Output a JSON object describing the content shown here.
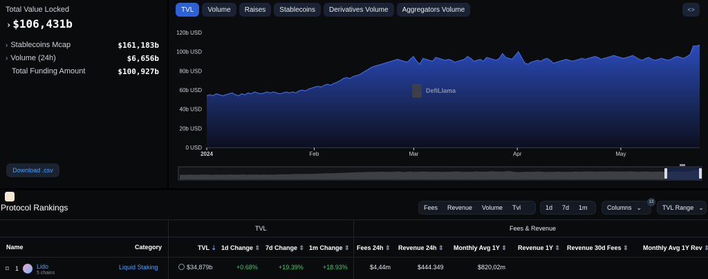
{
  "summary": {
    "tvl_label": "Total Value Locked",
    "tvl_value": "$106,431b",
    "stats": [
      {
        "label": "Stablecoins Mcap",
        "value": "$161,183b",
        "expandable": true
      },
      {
        "label": "Volume (24h)",
        "value": "$6,656b",
        "expandable": true
      },
      {
        "label": "Total Funding Amount",
        "value": "$100,927b",
        "expandable": false
      }
    ],
    "download_label": "Download .csv"
  },
  "chart_tabs": [
    "TVL",
    "Volume",
    "Raises",
    "Stablecoins",
    "Derivatives Volume",
    "Aggregators Volume"
  ],
  "active_tab": "TVL",
  "embed_label": "<>",
  "watermark": "DefiLlama",
  "chart_data": {
    "type": "area",
    "yticks": [
      "120b USD",
      "100b USD",
      "80b USD",
      "60b USD",
      "40b USD",
      "20b USD",
      "0 USD"
    ],
    "ylim": [
      0,
      120
    ],
    "xticks": [
      "2024",
      "Feb",
      "Mar",
      "Apr",
      "May"
    ],
    "series": [
      {
        "values": [
          54,
          55,
          54,
          56,
          55,
          54,
          55,
          56,
          57,
          55,
          54,
          56,
          55,
          57,
          56,
          58,
          57,
          56,
          57,
          58,
          57,
          58,
          57,
          56,
          57,
          58,
          57,
          58,
          57,
          59,
          60,
          59,
          61,
          62,
          63,
          64,
          63,
          65,
          66,
          65,
          67,
          68,
          70,
          72,
          73,
          72,
          74,
          75,
          76,
          78,
          80,
          82,
          84,
          85,
          86,
          87,
          88,
          89,
          90,
          91,
          92,
          91,
          90,
          89,
          92,
          95,
          90,
          87,
          93,
          92,
          91,
          90,
          94,
          93,
          92,
          91,
          92,
          91,
          89,
          90,
          91,
          92,
          95,
          93,
          90,
          91,
          92,
          90,
          94,
          93,
          92,
          91,
          93,
          98,
          94,
          93,
          92,
          96,
          100,
          94,
          88,
          87,
          89,
          90,
          91,
          90,
          92,
          93,
          91,
          88,
          89,
          90,
          91,
          92,
          91,
          90,
          91,
          92,
          93,
          92,
          93,
          94,
          95,
          94,
          92,
          93,
          94,
          95,
          96,
          95,
          94,
          93,
          94,
          95,
          96,
          94,
          92,
          91,
          93,
          94,
          92,
          91,
          92,
          93,
          92,
          91,
          92,
          94,
          95,
          94,
          93,
          95,
          97,
          106,
          106,
          107
        ]
      }
    ],
    "color": "#2c55d6"
  },
  "rankings": {
    "title": "Protocol Rankings",
    "metric_pills": [
      "Fees",
      "Revenue",
      "Volume",
      "Tvl"
    ],
    "period_pills": [
      "1d",
      "7d",
      "1m"
    ],
    "columns_label": "Columns",
    "columns_count": "13",
    "tvl_range_label": "TVL Range",
    "groups": [
      "TVL",
      "Fees & Revenue"
    ],
    "headers": [
      "Name",
      "Category",
      "TVL",
      "1d Change",
      "7d Change",
      "1m Change",
      "Fees 24h",
      "Revenue 24h",
      "Monthly Avg 1Y",
      "Revenue 1Y",
      "Revenue 30d Fees",
      "Monthly Avg 1Y Rev"
    ],
    "rows": [
      {
        "rank": "1",
        "name": "Lido",
        "chains": "5 chains",
        "category": "Liquid Staking",
        "tvl": "$34,879b",
        "change_1d": "+0.68%",
        "change_7d": "+19.39%",
        "change_1m": "+18.93%",
        "fees_24h": "$4,44m",
        "revenue_24h": "$444.349",
        "monthly_avg_1y": "$820,02m"
      }
    ]
  },
  "colors": {
    "accent": "#2c61d8",
    "positive": "#3ccd6a",
    "link": "#4aa0ff"
  }
}
